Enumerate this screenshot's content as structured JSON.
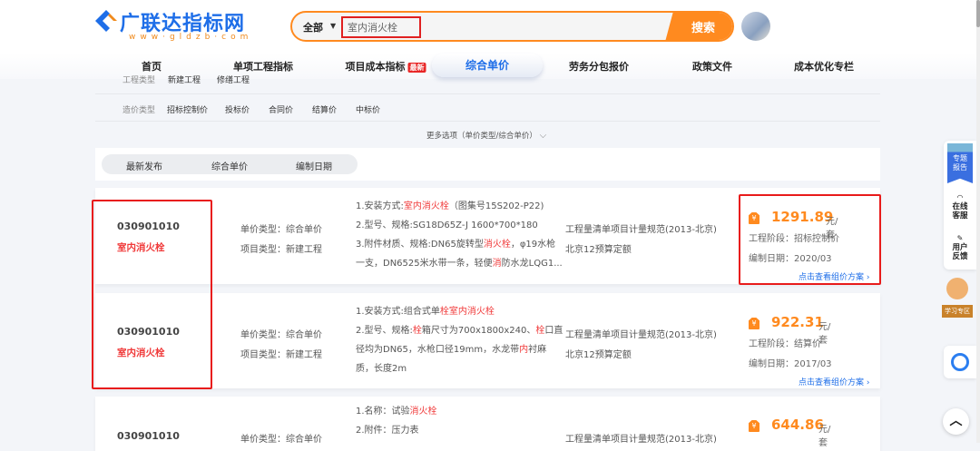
{
  "logo": {
    "name": "广联达指标网",
    "url": "www·gldzb·com"
  },
  "search": {
    "scope": "全部",
    "value": "室内消火栓",
    "button": "搜索"
  },
  "nav": [
    {
      "label": "首页"
    },
    {
      "label": "单项工程指标"
    },
    {
      "label": "项目成本指标",
      "badge": "最新"
    },
    {
      "label": "综合单价",
      "active": true
    },
    {
      "label": "劳务分包报价"
    },
    {
      "label": "政策文件"
    },
    {
      "label": "成本优化专栏"
    }
  ],
  "filters": {
    "project_type": {
      "label": "工程类型",
      "options": [
        "新建工程",
        "修缮工程"
      ]
    },
    "cost_type": {
      "label": "造价类型",
      "options": [
        "招标控制价",
        "投标价",
        "合同价",
        "结算价",
        "中标价"
      ]
    },
    "more": "更多选项（单价类型/综合单价）"
  },
  "sort_tabs": [
    "最新发布",
    "综合单价",
    "编制日期"
  ],
  "cards": [
    {
      "code": "030901010",
      "name": "室内消火栓",
      "unit_type": "单价类型：综合单价",
      "project_type": "项目类型：新建工程",
      "desc": [
        [
          {
            "t": "1.安装方式:"
          },
          {
            "t": "室内消火栓",
            "hl": true
          },
          {
            "t": "（图集号15S202-P22)"
          }
        ],
        [
          {
            "t": "2.型号、规格:SG18D65Z-J 1600*700*180"
          }
        ],
        [
          {
            "t": "3.附件材质、规格:DN65旋转型"
          },
          {
            "t": "消火栓",
            "hl": true
          },
          {
            "t": "，φ19水枪"
          }
        ],
        [
          {
            "t": "一支，DN6525米水带一条，轻便"
          },
          {
            "t": "消",
            "hl": true
          },
          {
            "t": "防水龙LQG1..."
          }
        ]
      ],
      "standard": "工程量清单项目计量规范(2013-北京)",
      "quota": "北京12预算定额",
      "price": "1291.89",
      "unit": "元/套",
      "stage": "工程阶段：招标控制价",
      "date": "编制日期：2020/03",
      "link": "点击查看组价方案"
    },
    {
      "code": "030901010",
      "name": "室内消火栓",
      "unit_type": "单价类型：综合单价",
      "project_type": "项目类型：新建工程",
      "desc": [
        [
          {
            "t": "1.安装方式:组合式单"
          },
          {
            "t": "栓室内消火栓",
            "hl": true
          }
        ],
        [
          {
            "t": "2.型号、规格:"
          },
          {
            "t": "栓",
            "hl": true
          },
          {
            "t": "箱尺寸为700x1800x240、"
          },
          {
            "t": "栓",
            "hl": true
          },
          {
            "t": "口直"
          }
        ],
        [
          {
            "t": "径均为DN65，水枪口径19mm，水龙带"
          },
          {
            "t": "内",
            "hl": true
          },
          {
            "t": "衬麻"
          }
        ],
        [
          {
            "t": "质，长度2m"
          }
        ]
      ],
      "standard": "工程量清单项目计量规范(2013-北京)",
      "quota": "北京12预算定额",
      "price": "922.31",
      "unit": "元/套",
      "stage": "工程阶段：结算价",
      "date": "编制日期：2017/03",
      "link": "点击查看组价方案"
    },
    {
      "code": "030901010",
      "unit_type": "单价类型：综合单价",
      "desc": [
        [
          {
            "t": "1.名称：试验"
          },
          {
            "t": "消火栓",
            "hl": true
          }
        ],
        [
          {
            "t": "2.附件：压力表"
          }
        ]
      ],
      "standard": "工程量清单项目计量规范(2013-北京)",
      "price": "644.86",
      "unit": "元/套"
    }
  ],
  "sidebar": {
    "report": "专题\n报告",
    "service": "在线\n客服",
    "feedback": "用户\n反馈",
    "study": "学习专区"
  },
  "colors": {
    "brand": "#1e6ee8",
    "accent": "#ff8a1f",
    "highlight": "#f03a3a"
  }
}
